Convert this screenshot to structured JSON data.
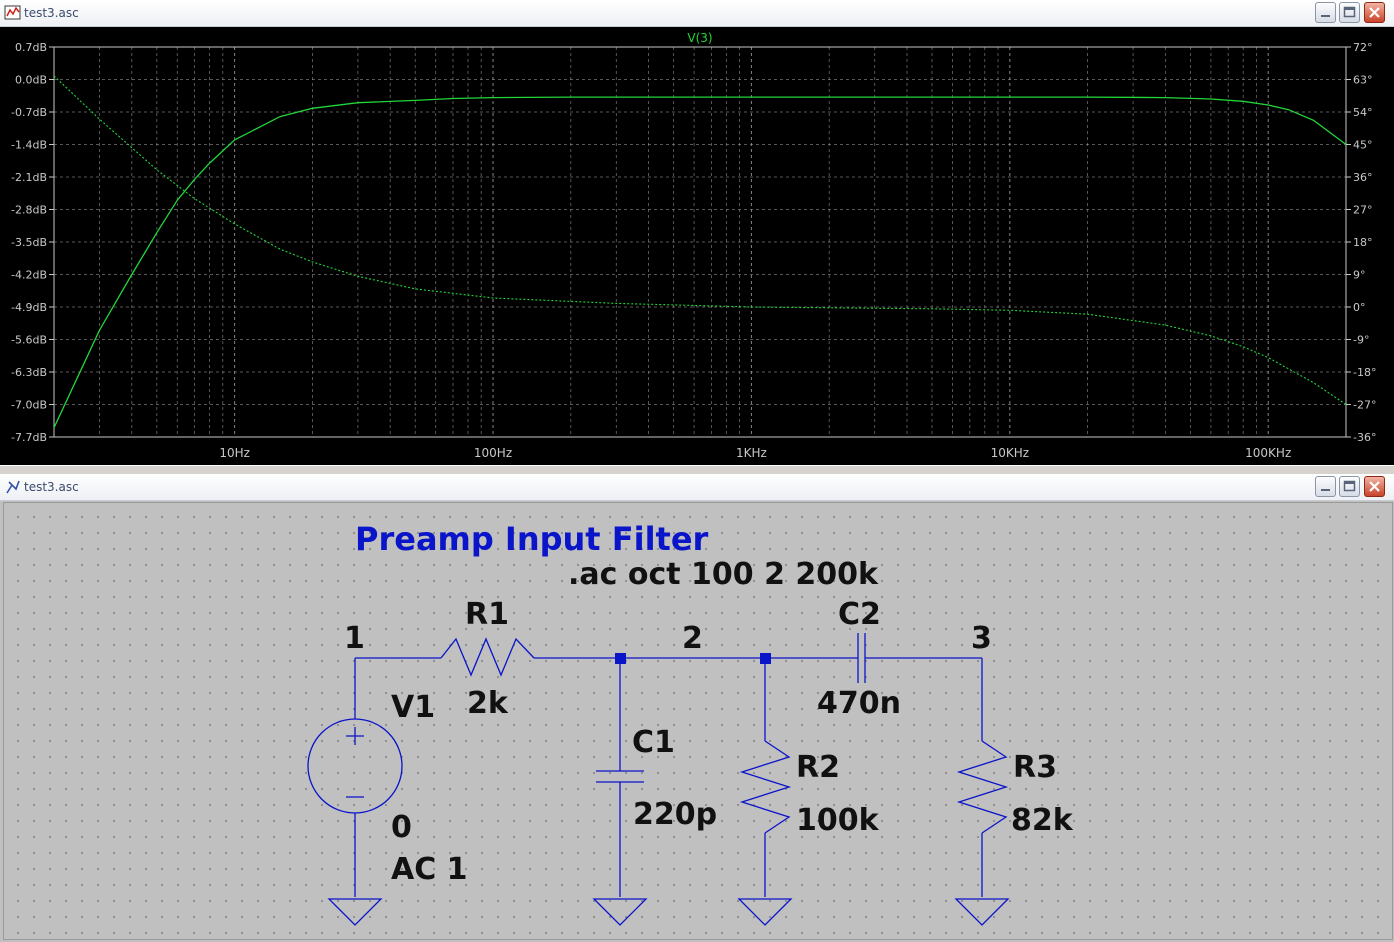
{
  "windows": {
    "plot": {
      "title": "test3.asc"
    },
    "schematic": {
      "title": "test3.asc"
    }
  },
  "colors": {
    "plot_bg": "#000000",
    "trace": "#22d63a",
    "grid": "#8c8c8c",
    "axis_text": "#c8c8c8",
    "wire": "#0a14c8",
    "schematic_bg": "#c0c0c0",
    "title_blue": "#0a14c8"
  },
  "icons": {
    "plot_window": "waveform-icon",
    "schematic_window": "schematic-icon",
    "minimize": "minimize-icon",
    "maximize": "maximize-icon",
    "close": "close-icon"
  },
  "chart_data": {
    "type": "line",
    "title": "V(3)",
    "x_scale": "log",
    "xlim": [
      2,
      200000
    ],
    "x_ticks": [
      "10Hz",
      "100Hz",
      "1KHz",
      "10KHz",
      "100KHz"
    ],
    "y_left_ticks": [
      "0.7dB",
      "0.0dB",
      "-0.7dB",
      "-1.4dB",
      "-2.1dB",
      "-2.8dB",
      "-3.5dB",
      "-4.2dB",
      "-4.9dB",
      "-5.6dB",
      "-6.3dB",
      "-7.0dB",
      "-7.7dB"
    ],
    "y_right_ticks": [
      "72°",
      "63°",
      "54°",
      "45°",
      "36°",
      "27°",
      "18°",
      "9°",
      "0°",
      "-9°",
      "-18°",
      "-27°",
      "-36°"
    ],
    "ylim_left": [
      -7.7,
      0.7
    ],
    "ylim_right": [
      -36,
      72
    ],
    "grid": true,
    "series": [
      {
        "name": "V(3)",
        "style": "solid",
        "axis": "left",
        "x": [
          2,
          3,
          4,
          5,
          6,
          7,
          8,
          10,
          15,
          20,
          30,
          50,
          70,
          100,
          200,
          1000,
          5000,
          10000,
          20000,
          40000,
          60000,
          80000,
          100000,
          120000,
          150000,
          200000
        ],
        "y": [
          -7.5,
          -5.4,
          -4.2,
          -3.3,
          -2.6,
          -2.15,
          -1.8,
          -1.3,
          -0.8,
          -0.62,
          -0.5,
          -0.45,
          -0.41,
          -0.39,
          -0.38,
          -0.38,
          -0.38,
          -0.38,
          -0.38,
          -0.39,
          -0.42,
          -0.47,
          -0.55,
          -0.65,
          -0.88,
          -1.4
        ]
      },
      {
        "style": "dotted",
        "axis": "right",
        "x": [
          2,
          3,
          5,
          7,
          10,
          15,
          20,
          30,
          50,
          100,
          300,
          1000,
          5000,
          10000,
          20000,
          40000,
          60000,
          80000,
          100000,
          150000,
          200000
        ],
        "y": [
          64,
          52,
          38,
          30,
          23,
          16,
          12.5,
          8.5,
          5,
          2.5,
          1,
          0,
          -0.5,
          -0.9,
          -2,
          -5,
          -8,
          -11,
          -14,
          -21,
          -27
        ]
      }
    ]
  },
  "schematic": {
    "title": "Preamp Input Filter",
    "directive": ".ac oct 100 2 200k",
    "nets": [
      "1",
      "2",
      "3"
    ],
    "components": [
      {
        "ref": "R1",
        "value": "2k"
      },
      {
        "ref": "C1",
        "value": "220p"
      },
      {
        "ref": "R2",
        "value": "100k"
      },
      {
        "ref": "C2",
        "value": "470n"
      },
      {
        "ref": "R3",
        "value": "82k"
      },
      {
        "ref": "V1",
        "value": "0",
        "value2": "AC 1"
      }
    ]
  }
}
